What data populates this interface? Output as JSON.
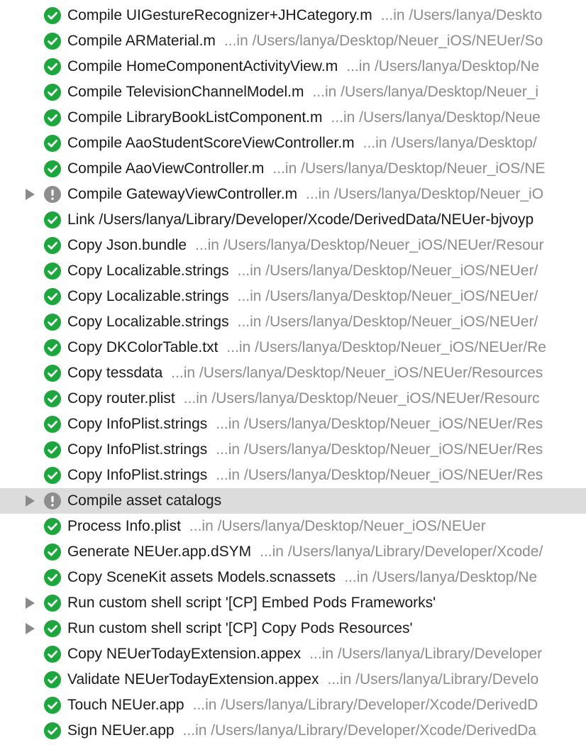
{
  "colors": {
    "success": "#1aa83a",
    "warning": "#8e8e8e",
    "selected_row": "#dcdcdc",
    "title_text": "#1a1a1a",
    "location_text": "#8c8c8c"
  },
  "build_log": {
    "rows": [
      {
        "status": "success-icon",
        "disclosure": false,
        "title": "Compile UIGestureRecognizer+JHCategory.m",
        "location": "...in /Users/lanya/Deskto"
      },
      {
        "status": "success-icon",
        "disclosure": false,
        "title": "Compile ARMaterial.m",
        "location": "...in /Users/lanya/Desktop/Neuer_iOS/NEUer/So"
      },
      {
        "status": "success-icon",
        "disclosure": false,
        "title": "Compile HomeComponentActivityView.m",
        "location": "...in /Users/lanya/Desktop/Ne"
      },
      {
        "status": "success-icon",
        "disclosure": false,
        "title": "Compile TelevisionChannelModel.m",
        "location": "...in /Users/lanya/Desktop/Neuer_i"
      },
      {
        "status": "success-icon",
        "disclosure": false,
        "title": "Compile LibraryBookListComponent.m",
        "location": "...in /Users/lanya/Desktop/Neue"
      },
      {
        "status": "success-icon",
        "disclosure": false,
        "title": "Compile AaoStudentScoreViewController.m",
        "location": "...in /Users/lanya/Desktop/"
      },
      {
        "status": "success-icon",
        "disclosure": false,
        "title": "Compile AaoViewController.m",
        "location": "...in /Users/lanya/Desktop/Neuer_iOS/NE"
      },
      {
        "status": "warning-icon",
        "disclosure": true,
        "title": "Compile GatewayViewController.m",
        "location": "...in /Users/lanya/Desktop/Neuer_iO"
      },
      {
        "status": "success-icon",
        "disclosure": false,
        "title": "Link /Users/lanya/Library/Developer/Xcode/DerivedData/NEUer-bjvoyp",
        "location": ""
      },
      {
        "status": "success-icon",
        "disclosure": false,
        "title": "Copy Json.bundle",
        "location": "...in /Users/lanya/Desktop/Neuer_iOS/NEUer/Resour"
      },
      {
        "status": "success-icon",
        "disclosure": false,
        "title": "Copy Localizable.strings",
        "location": "...in /Users/lanya/Desktop/Neuer_iOS/NEUer/"
      },
      {
        "status": "success-icon",
        "disclosure": false,
        "title": "Copy Localizable.strings",
        "location": "...in /Users/lanya/Desktop/Neuer_iOS/NEUer/"
      },
      {
        "status": "success-icon",
        "disclosure": false,
        "title": "Copy Localizable.strings",
        "location": "...in /Users/lanya/Desktop/Neuer_iOS/NEUer/"
      },
      {
        "status": "success-icon",
        "disclosure": false,
        "title": "Copy DKColorTable.txt",
        "location": "...in /Users/lanya/Desktop/Neuer_iOS/NEUer/Re"
      },
      {
        "status": "success-icon",
        "disclosure": false,
        "title": "Copy tessdata",
        "location": "...in /Users/lanya/Desktop/Neuer_iOS/NEUer/Resources"
      },
      {
        "status": "success-icon",
        "disclosure": false,
        "title": "Copy router.plist",
        "location": "...in /Users/lanya/Desktop/Neuer_iOS/NEUer/Resourc"
      },
      {
        "status": "success-icon",
        "disclosure": false,
        "title": "Copy InfoPlist.strings",
        "location": "...in /Users/lanya/Desktop/Neuer_iOS/NEUer/Res"
      },
      {
        "status": "success-icon",
        "disclosure": false,
        "title": "Copy InfoPlist.strings",
        "location": "...in /Users/lanya/Desktop/Neuer_iOS/NEUer/Res"
      },
      {
        "status": "success-icon",
        "disclosure": false,
        "title": "Copy InfoPlist.strings",
        "location": "...in /Users/lanya/Desktop/Neuer_iOS/NEUer/Res"
      },
      {
        "status": "warning-icon",
        "disclosure": true,
        "selected": true,
        "title": "Compile asset catalogs",
        "location": ""
      },
      {
        "status": "success-icon",
        "disclosure": false,
        "title": "Process Info.plist",
        "location": "...in /Users/lanya/Desktop/Neuer_iOS/NEUer"
      },
      {
        "status": "success-icon",
        "disclosure": false,
        "title": "Generate NEUer.app.dSYM",
        "location": "...in /Users/lanya/Library/Developer/Xcode/"
      },
      {
        "status": "success-icon",
        "disclosure": false,
        "title": "Copy SceneKit assets Models.scnassets",
        "location": "...in /Users/lanya/Desktop/Ne"
      },
      {
        "status": "success-icon",
        "disclosure": true,
        "title": "Run custom shell script '[CP] Embed Pods Frameworks'",
        "location": ""
      },
      {
        "status": "success-icon",
        "disclosure": true,
        "title": "Run custom shell script '[CP] Copy Pods Resources'",
        "location": ""
      },
      {
        "status": "success-icon",
        "disclosure": false,
        "title": "Copy NEUerTodayExtension.appex",
        "location": "...in /Users/lanya/Library/Developer"
      },
      {
        "status": "success-icon",
        "disclosure": false,
        "title": "Validate NEUerTodayExtension.appex",
        "location": "...in /Users/lanya/Library/Develo"
      },
      {
        "status": "success-icon",
        "disclosure": false,
        "title": "Touch NEUer.app",
        "location": "...in /Users/lanya/Library/Developer/Xcode/DerivedD"
      },
      {
        "status": "success-icon",
        "disclosure": false,
        "title": "Sign NEUer.app",
        "location": "...in /Users/lanya/Library/Developer/Xcode/DerivedDa"
      }
    ]
  }
}
